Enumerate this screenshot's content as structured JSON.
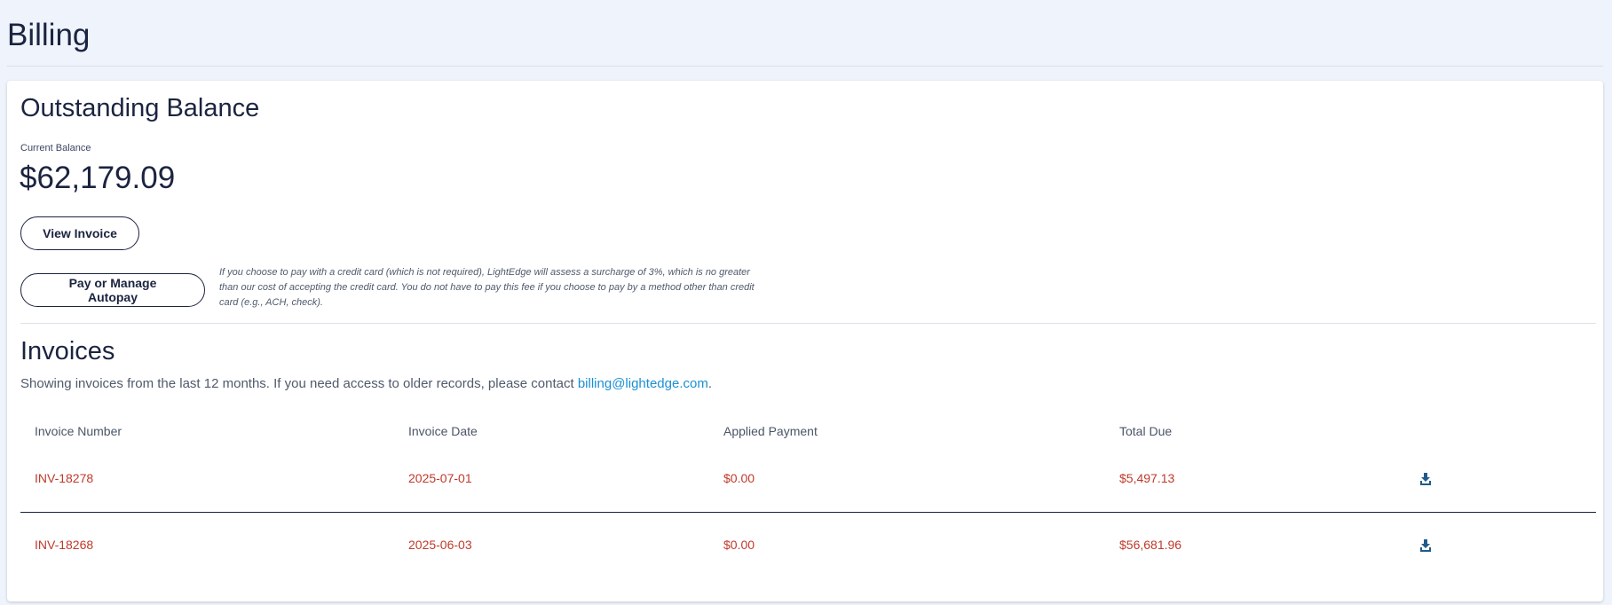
{
  "page": {
    "title": "Billing"
  },
  "balance": {
    "title": "Outstanding Balance",
    "label": "Current Balance",
    "amount": "$62,179.09",
    "view_invoice_label": "View Invoice",
    "pay_label": "Pay or Manage Autopay",
    "surcharge_note": "If you choose to pay with a credit card (which is not required), LightEdge will assess a surcharge of 3%, which is no greater than our cost of accepting the credit card. You do not have to pay this fee if you choose to pay by a method other than credit card (e.g., ACH, check)."
  },
  "invoices": {
    "title": "Invoices",
    "description_prefix": "Showing invoices from the last 12 months. If you need access to older records, please contact ",
    "email": "billing@lightedge.com",
    "description_suffix": ".",
    "columns": [
      "Invoice Number",
      "Invoice Date",
      "Applied Payment",
      "Total Due"
    ],
    "rows": [
      {
        "number": "INV-18278",
        "date": "2025-07-01",
        "applied": "$0.00",
        "total": "$5,497.13",
        "icon": "download-icon"
      },
      {
        "number": "INV-18268",
        "date": "2025-06-03",
        "applied": "$0.00",
        "total": "$56,681.96",
        "icon": "download-icon"
      }
    ]
  },
  "colors": {
    "navy": "#1b2440",
    "link": "#1a8fd4",
    "invoice_text": "#c0392b",
    "icon": "#1f5b8c",
    "background": "#eff3fb"
  }
}
